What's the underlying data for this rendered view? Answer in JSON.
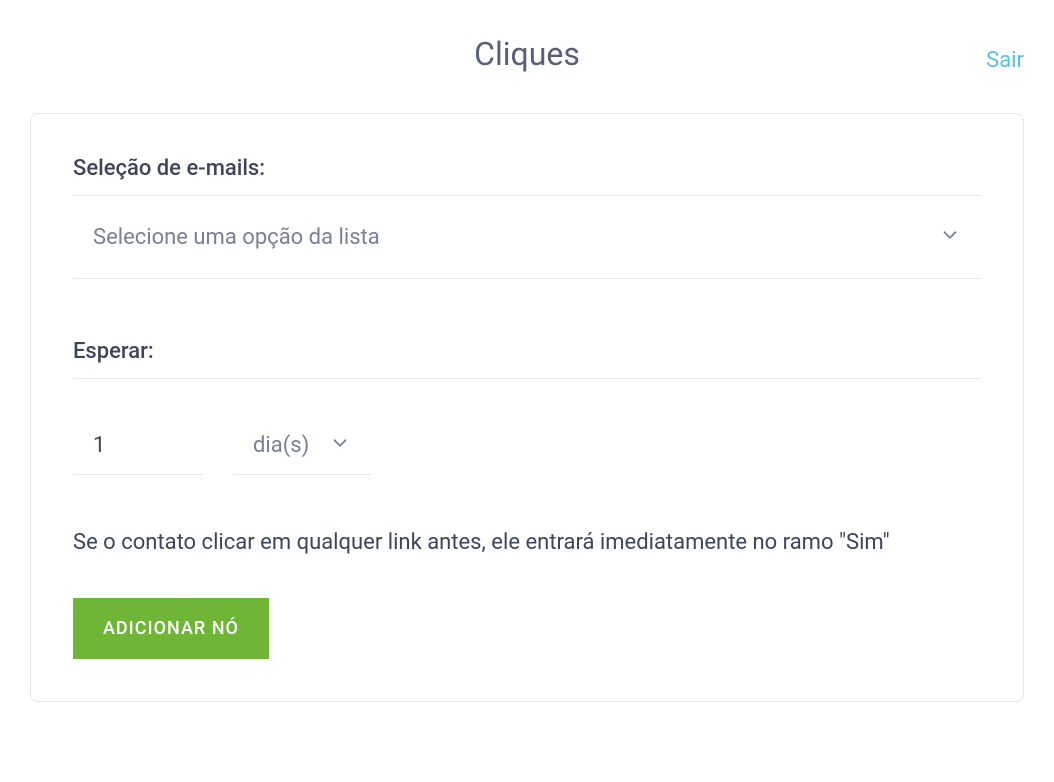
{
  "header": {
    "title": "Cliques",
    "exit": "Sair"
  },
  "emailSelection": {
    "label": "Seleção de e-mails:",
    "placeholder": "Selecione uma opção da lista"
  },
  "wait": {
    "label": "Esperar:",
    "value": "1",
    "unit": "dia(s)"
  },
  "hint": "Se o contato clicar em qualquer link antes, ele entrará imediatamente no ramo \"Sim\"",
  "button": {
    "addNode": "ADICIONAR NÓ"
  }
}
